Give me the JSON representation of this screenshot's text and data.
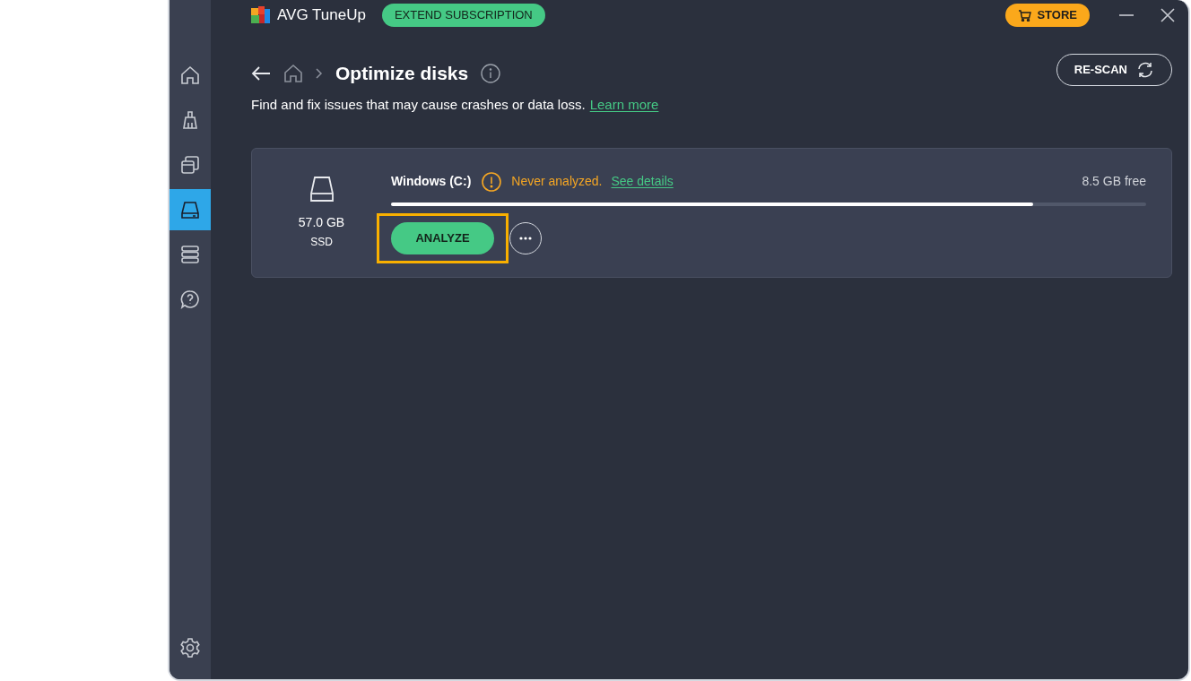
{
  "app": {
    "name": "AVG TuneUp",
    "subscription_button": "EXTEND SUBSCRIPTION",
    "store_button": "STORE"
  },
  "sidebar": {
    "items": [
      {
        "selected": false
      },
      {
        "selected": false
      },
      {
        "selected": false
      },
      {
        "selected": true
      },
      {
        "selected": false
      },
      {
        "selected": false
      }
    ]
  },
  "header": {
    "title": "Optimize disks",
    "description": "Find and fix issues that may cause crashes or data loss.",
    "learn_more": "Learn more",
    "rescan_button": "RE-SCAN"
  },
  "disks": [
    {
      "size": "57.0 GB",
      "type": "SSD",
      "name": "Windows (C:)",
      "status": "Never analyzed.",
      "details_link": "See details",
      "free": "8.5 GB free",
      "level": 0.85,
      "analyze_button": "ANALYZE",
      "highlighted": true
    }
  ]
}
